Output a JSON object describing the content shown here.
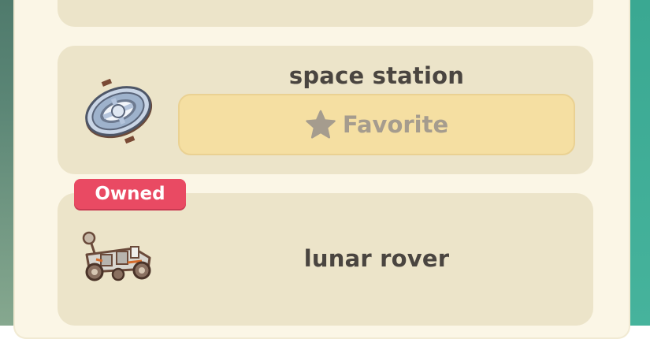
{
  "items": [
    {
      "name": "space station",
      "favorite_label": "Favorite",
      "thumbnail_icon": "space-station-icon",
      "owned": false
    },
    {
      "name": "lunar rover",
      "thumbnail_icon": "lunar-rover-icon",
      "owned": true,
      "badge_label": "Owned"
    }
  ],
  "colors": {
    "panel_bg": "#fbf6e6",
    "card_bg": "#ece4c9",
    "favorite_bg": "#f5dfa2",
    "owned_badge": "#e94a63",
    "text": "#4a4540",
    "muted_text": "#a59c8e"
  }
}
